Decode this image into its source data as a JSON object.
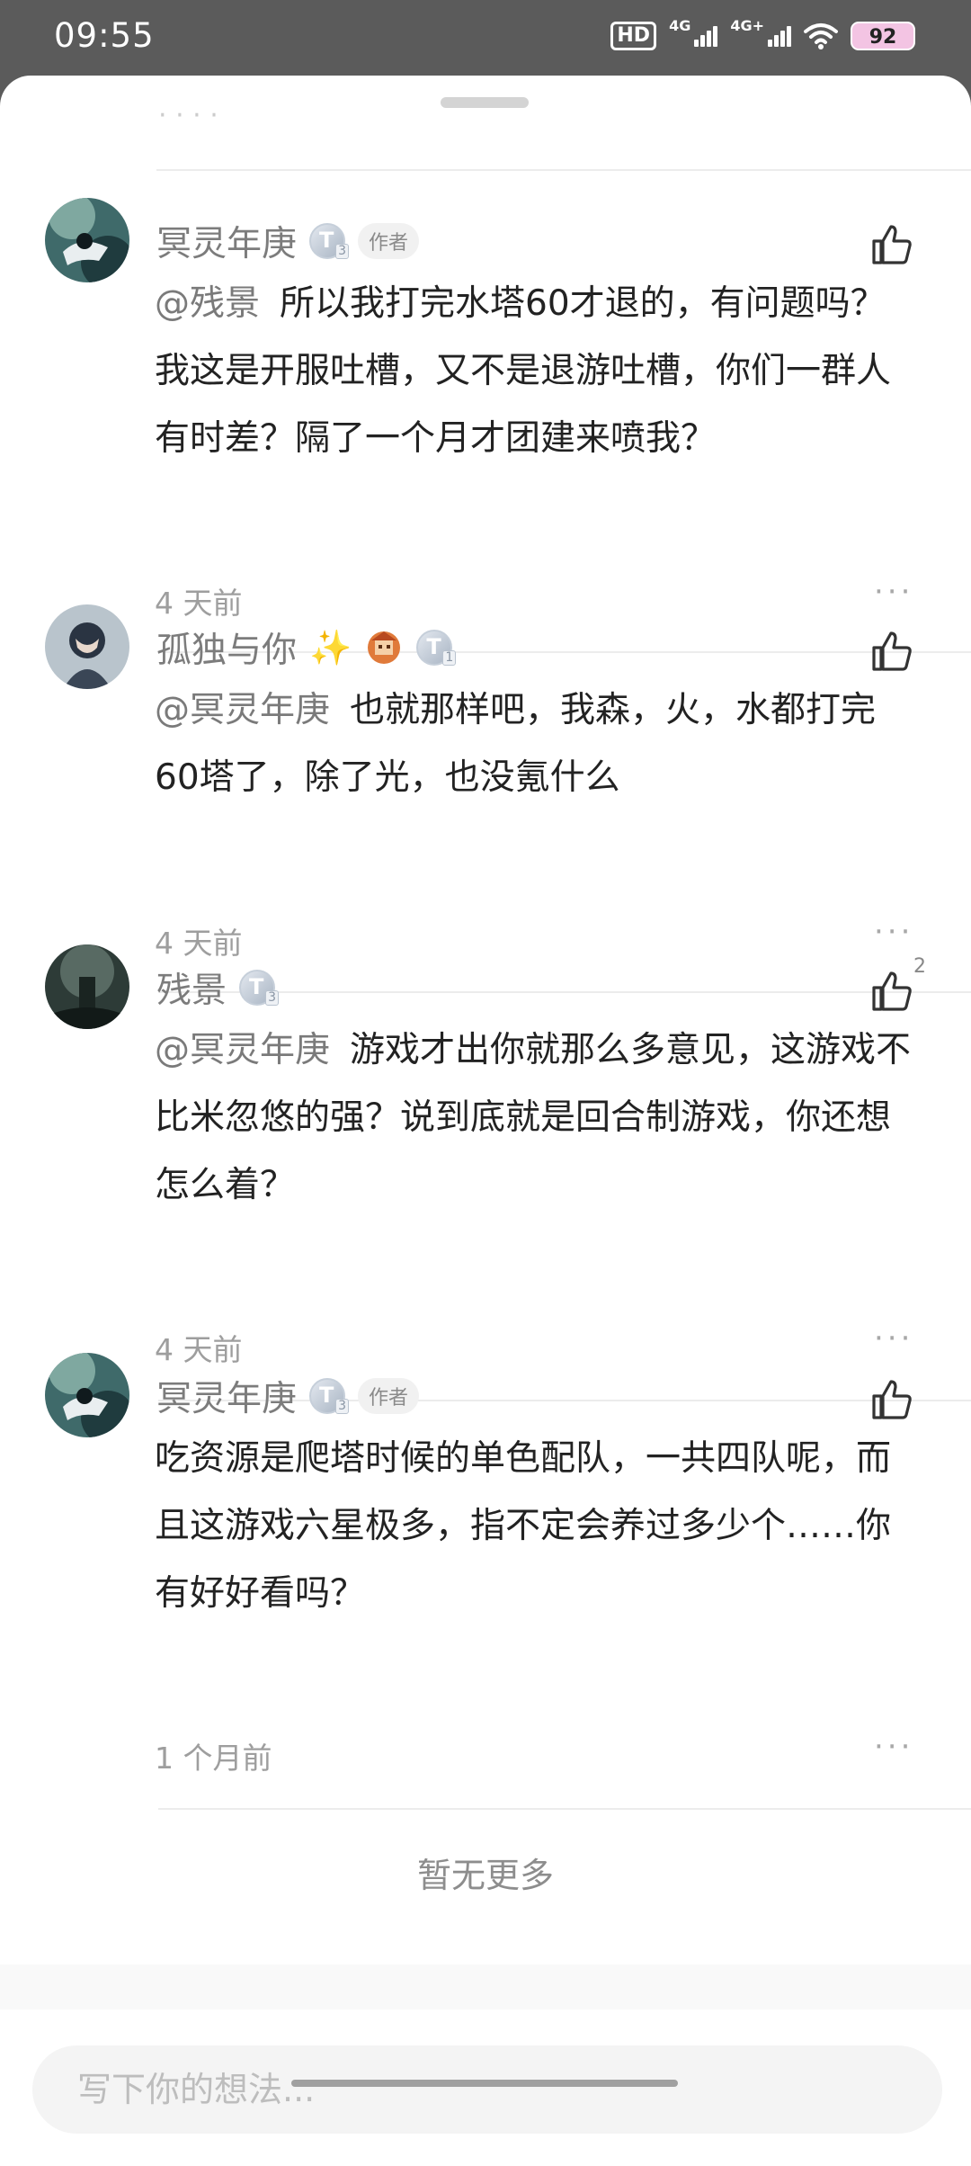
{
  "status_bar": {
    "time": "09:55",
    "hd_label": "HD",
    "net1_label": "4G",
    "net2_label": "4G+",
    "battery": "92"
  },
  "comments": [
    {
      "name": "冥灵年庚",
      "is_author": true,
      "author_label": "作者",
      "mention": "@残景",
      "text": "所以我打完水塔60才退的，有问题吗？我这是开服吐槽，又不是退游吐槽，你们一群人有时差？隔了一个月才团建来喷我？",
      "time": "4 天前",
      "likes": ""
    },
    {
      "name": "孤独与你",
      "is_author": false,
      "mention": "@冥灵年庚",
      "text": "也就那样吧，我森，火，水都打完60塔了，除了光，也没氪什么",
      "time": "4 天前",
      "likes": ""
    },
    {
      "name": "残景",
      "is_author": false,
      "mention": "@冥灵年庚",
      "text": "游戏才出你就那么多意见，这游戏不比米忽悠的强？说到底就是回合制游戏，你还想怎么着？",
      "time": "4 天前",
      "likes": "2"
    },
    {
      "name": "冥灵年庚",
      "is_author": true,
      "author_label": "作者",
      "mention": "",
      "text": "吃资源是爬塔时候的单色配队，一共四队呢，而且这游戏六星极多，指不定会养过多少个……你有好好看吗？",
      "time": "1 个月前",
      "likes": ""
    }
  ],
  "footer": {
    "no_more": "暂无更多",
    "input_placeholder": "写下你的想法..."
  },
  "icons": {
    "like": "thumbs-up-icon",
    "more": "more-dots-icon",
    "level": "level-badge-icon"
  },
  "colors": {
    "accent_battery": "#f3c4e3",
    "status_bar_bg": "#5b5b5b"
  }
}
